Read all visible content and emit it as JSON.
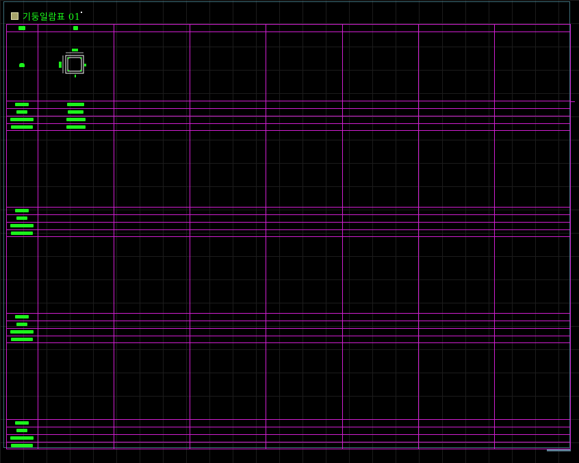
{
  "drawing": {
    "title": "기둥일람표 01",
    "title_marker_icon": "square-layer-icon"
  },
  "table": {
    "columns": 8,
    "bands": 4,
    "rows_per_band": 4
  },
  "colors": {
    "background": "#000000",
    "table_line": "#d21fd2",
    "text_placeholder": "#1cf21c",
    "frame": "#3e6f7a",
    "column_section": "#ffffff"
  }
}
